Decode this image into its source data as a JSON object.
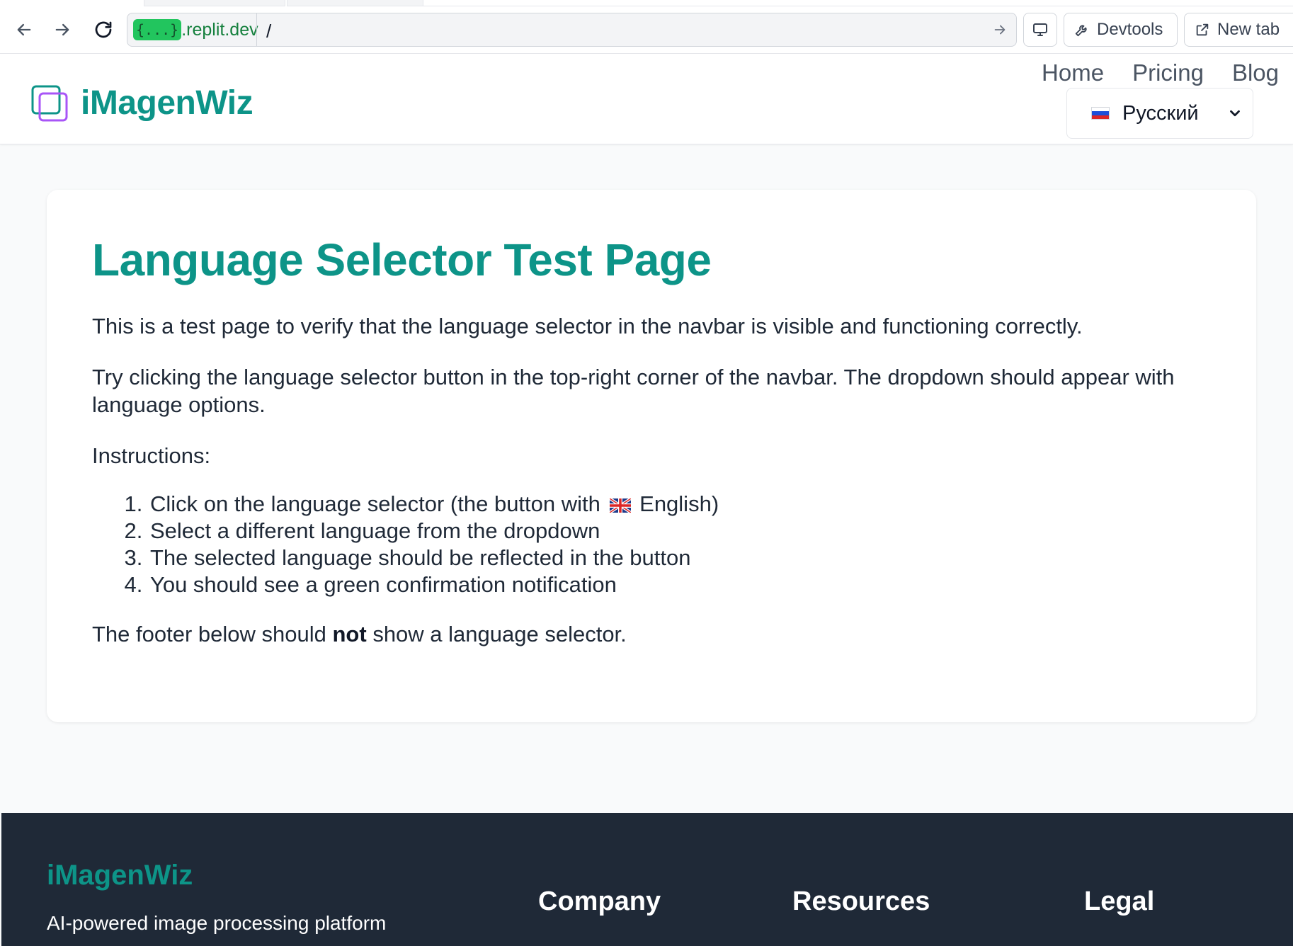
{
  "browser": {
    "url_host_badge": "{...}",
    "url_host": ".replit.dev",
    "url_path": "/",
    "devtools_label": "Devtools",
    "new_tab_label": "New tab"
  },
  "navbar": {
    "brand": "iMagenWiz",
    "links": [
      "Home",
      "Pricing",
      "Blog"
    ],
    "language": {
      "label": "Русский"
    }
  },
  "main": {
    "title": "Language Selector Test Page",
    "p1": "This is a test page to verify that the language selector in the navbar is visible and functioning correctly.",
    "p2": "Try clicking the language selector button in the top-right corner of the navbar. The dropdown should appear with language options.",
    "instructions_label": "Instructions:",
    "steps": {
      "s1_before": "Click on the language selector (the button with",
      "s1_after": "English)",
      "s2": "Select a different language from the dropdown",
      "s3": "The selected language should be reflected in the button",
      "s4": "You should see a green confirmation notification"
    },
    "p4_before": "The footer below should ",
    "p4_bold": "not",
    "p4_after": " show a language selector."
  },
  "footer": {
    "brand": "iMagenWiz",
    "tagline": "AI-powered image processing platform",
    "columns": [
      "Company",
      "Resources",
      "Legal"
    ]
  },
  "colors": {
    "brand_teal": "#0d9488",
    "footer_bg": "#1f2937",
    "page_bg": "#f9fafb",
    "url_badge": "#22c55e"
  }
}
